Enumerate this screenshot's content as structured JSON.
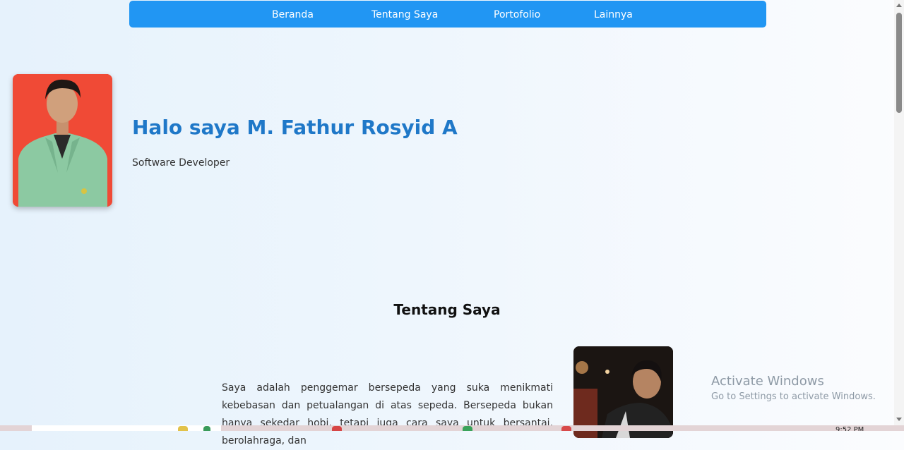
{
  "nav": {
    "items": [
      {
        "label": "Beranda"
      },
      {
        "label": "Tentang Saya"
      },
      {
        "label": "Portofolio"
      },
      {
        "label": "Lainnya"
      }
    ]
  },
  "hero": {
    "title": "Halo saya M. Fathur Rosyid A",
    "subtitle": "Software Developer"
  },
  "about": {
    "title": "Tentang Saya",
    "paragraph": "Saya adalah penggemar bersepeda yang suka menikmati kebebasan dan petualangan di atas sepeda. Bersepeda bukan hanya sekedar hobi, tetapi juga cara saya untuk bersantai, berolahraga, dan"
  },
  "watermark": {
    "title": "Activate Windows",
    "subtitle": "Go to Settings to activate Windows."
  },
  "taskbar": {
    "clock": "9:52 PM"
  },
  "colors": {
    "nav_bg": "#2196f3",
    "title_blue": "#1f78c8",
    "photo_bg_red": "#f04a36"
  }
}
